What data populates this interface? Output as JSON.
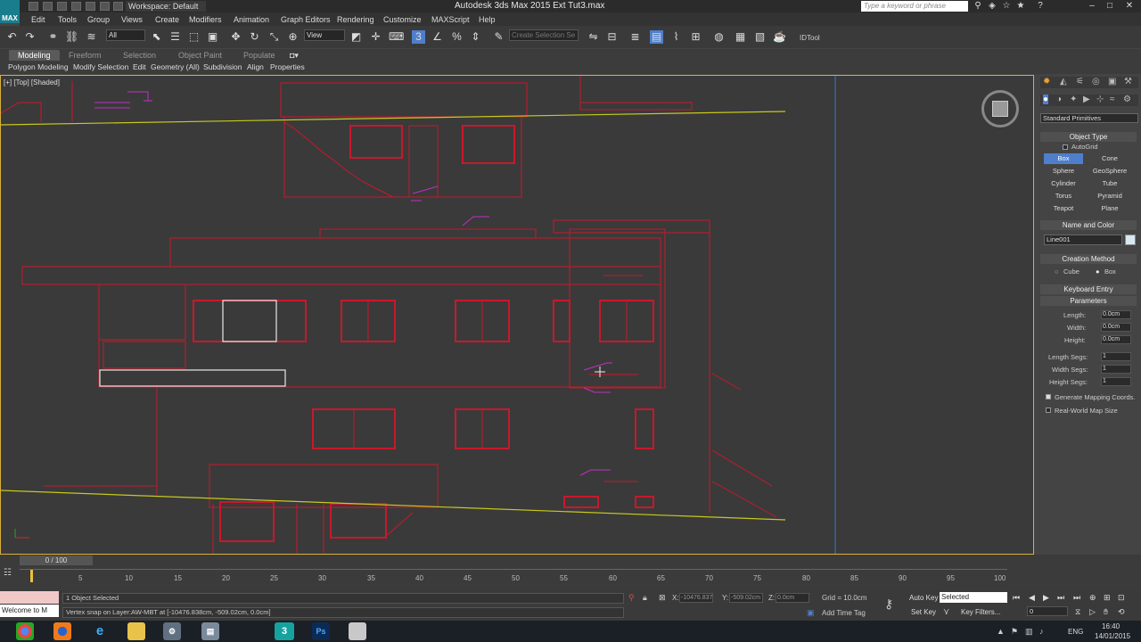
{
  "app": {
    "logo": "MAX",
    "title": "Autodesk 3ds Max  2015      Ext Tut3.max",
    "search_placeholder": "Type a keyword or phrase",
    "workspace": "Workspace: Default"
  },
  "menu": [
    "Edit",
    "Tools",
    "Group",
    "Views",
    "Create",
    "Modifiers",
    "Animation",
    "Graph Editors",
    "Rendering",
    "Customize",
    "MAXScript",
    "Help"
  ],
  "toolbar": {
    "selection_filter": "All",
    "reference_coord": "View",
    "named_selection": "Create Selection Se",
    "idtool": "IDTool"
  },
  "ribbon": {
    "tabs": [
      "Modeling",
      "Freeform",
      "Selection",
      "Object Paint",
      "Populate"
    ],
    "active_tab": "Modeling",
    "subtabs": [
      "Polygon Modeling",
      "Modify Selection",
      "Edit",
      "Geometry (All)",
      "Subdivision",
      "Align",
      "Properties"
    ]
  },
  "viewport": {
    "label": "[+] [Top] [Shaded]"
  },
  "command_panel": {
    "dropdown": "Standard Primitives",
    "object_type_header": "Object Type",
    "autogrid": "AutoGrid",
    "objects": [
      "Box",
      "Cone",
      "Sphere",
      "GeoSphere",
      "Cylinder",
      "Tube",
      "Torus",
      "Pyramid",
      "Teapot",
      "Plane"
    ],
    "selected_object": "Box",
    "name_color_header": "Name and Color",
    "name_value": "Line001",
    "creation_method_header": "Creation Method",
    "creation_options": [
      "Cube",
      "Box"
    ],
    "keyboard_entry": "Keyboard Entry",
    "parameters_header": "Parameters",
    "params": [
      {
        "label": "Length:",
        "value": "0.0cm"
      },
      {
        "label": "Width:",
        "value": "0.0cm"
      },
      {
        "label": "Height:",
        "value": "0.0cm"
      }
    ],
    "segs": [
      {
        "label": "Length Segs:",
        "value": "1"
      },
      {
        "label": "Width Segs:",
        "value": "1"
      },
      {
        "label": "Height Segs:",
        "value": "1"
      }
    ],
    "gen_mapping": "Generate Mapping Coords.",
    "real_world": "Real-World Map Size"
  },
  "timeline": {
    "slider": "0 / 100",
    "ticks": [
      "5",
      "10",
      "15",
      "20",
      "25",
      "30",
      "35",
      "40",
      "45",
      "50",
      "55",
      "60",
      "65",
      "70",
      "75",
      "80",
      "85",
      "90",
      "95",
      "100"
    ]
  },
  "status": {
    "welcome": "Welcome to M",
    "selected": "1 Object Selected",
    "prompt": "Vertex snap on Layer:AW-MBT at [-10476.838cm, -509.02cm, 0.0cm]",
    "x_label": "X:",
    "x_value": "-10476.837",
    "y_label": "Y:",
    "y_value": "-509.02cm",
    "z_label": "Z:",
    "z_value": "0.0cm",
    "grid": "Grid = 10.0cm",
    "add_time_tag": "Add Time Tag",
    "auto_key": "Auto Key",
    "auto_key_value": "Selected",
    "set_key": "Set Key",
    "key_filters": "Key Filters...",
    "frame": "0"
  },
  "taskbar": {
    "time": "16:40",
    "date": "14/01/2015",
    "lang": "ENG",
    "apps": [
      "chrome",
      "firefox",
      "ie",
      "explorer",
      "network",
      "files",
      "3dsmax",
      "photoshop",
      "notepad"
    ]
  },
  "colors": {
    "wire_red": "#c8182c",
    "wire_yellow": "#c8c81e",
    "wire_magenta": "#c030c0",
    "active_blue": "#4f7fcc",
    "viewport_border": "#d8b03c"
  }
}
